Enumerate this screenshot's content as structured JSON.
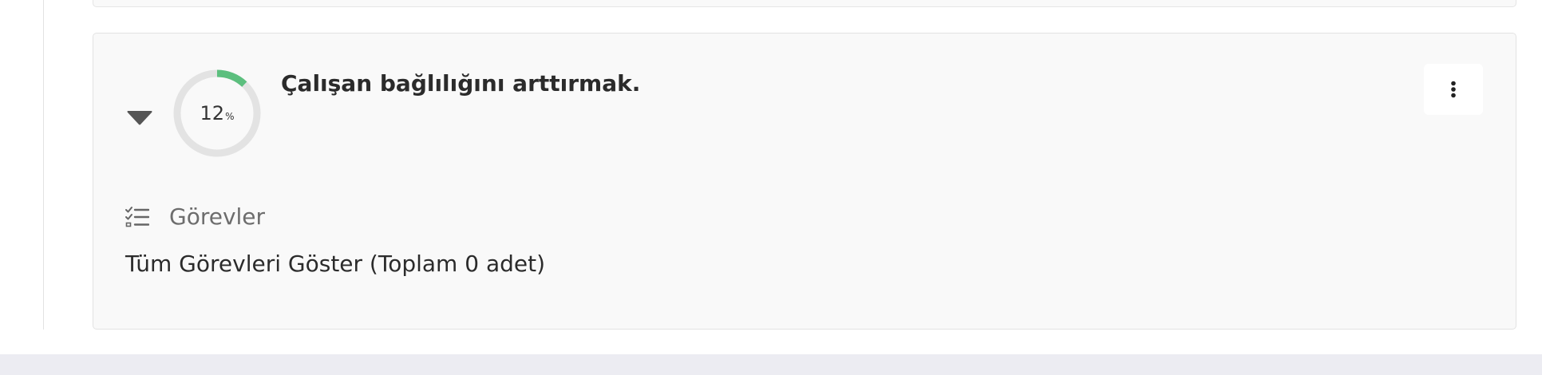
{
  "goal": {
    "title": "Çalışan bağlılığını arttırmak.",
    "progress_percent": 12,
    "progress_number": "12",
    "progress_sign": "%"
  },
  "tasks": {
    "label": "Görevler",
    "show_all_label": "Tüm Görevleri Göster (Toplam 0 adet)",
    "icon": "checklist-icon"
  },
  "icons": {
    "toggle": "caret-down-icon",
    "menu": "more-vertical-icon"
  },
  "colors": {
    "progress_fill": "#5cbf7e",
    "progress_track": "#e3e3e3",
    "card_background": "#f9f9f9",
    "muted_text": "#6d6d6d"
  }
}
